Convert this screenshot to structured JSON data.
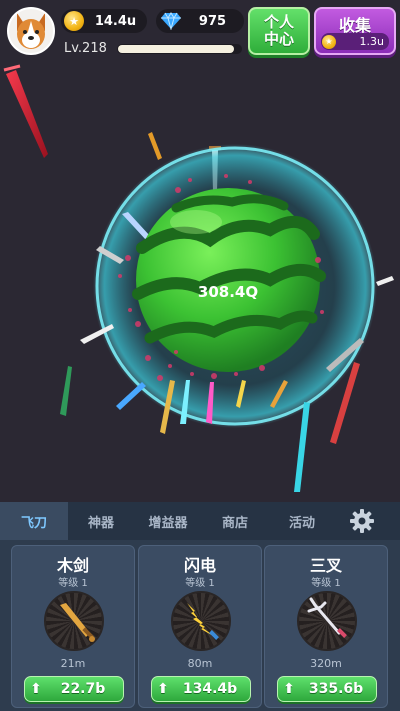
{
  "player": {
    "level": "Lv.218",
    "level_progress": 0.94
  },
  "currency": {
    "coins": "14.4u",
    "gems": "975"
  },
  "buttons": {
    "personal_center": "个人中心",
    "collect": "收集",
    "collect_amount": "1.3u"
  },
  "target": {
    "hp": "308.4Q"
  },
  "tabs": [
    {
      "label": "飞刀",
      "active": true
    },
    {
      "label": "神器",
      "active": false
    },
    {
      "label": "增益器",
      "active": false
    },
    {
      "label": "商店",
      "active": false
    },
    {
      "label": "活动",
      "active": false
    }
  ],
  "cards": [
    {
      "name": "木剑",
      "level": "等级 1",
      "distance": "21m",
      "upgrade_cost": "22.7b"
    },
    {
      "name": "闪电",
      "level": "等级 1",
      "distance": "80m",
      "upgrade_cost": "134.4b"
    },
    {
      "name": "三叉",
      "level": "等级 1",
      "distance": "320m",
      "upgrade_cost": "335.6b"
    }
  ],
  "colors": {
    "accent_green": "#3fbf4a",
    "accent_purple": "#a53fd0",
    "shield_cyan": "#66f4ff",
    "tab_active": "#7fc8ff"
  },
  "icons": [
    "dog-avatar",
    "coin-icon",
    "gem-icon",
    "settings-gear-icon",
    "up-arrow-icon"
  ]
}
